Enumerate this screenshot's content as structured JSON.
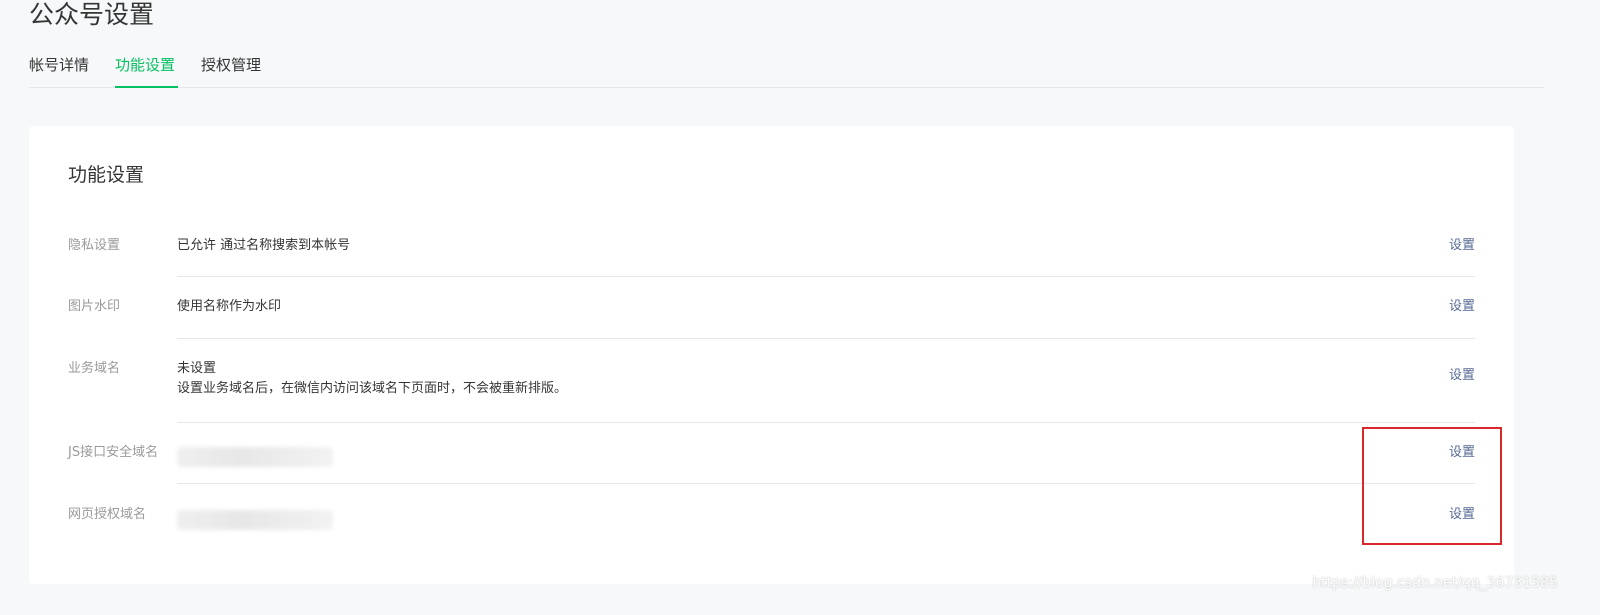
{
  "page": {
    "title": "公众号设置"
  },
  "tabs": [
    {
      "label": "帐号详情",
      "active": false
    },
    {
      "label": "功能设置",
      "active": true
    },
    {
      "label": "授权管理",
      "active": false
    }
  ],
  "card": {
    "title": "功能设置",
    "rows": [
      {
        "label": "隐私设置",
        "value": "已允许 通过名称搜索到本帐号",
        "action": "设置"
      },
      {
        "label": "图片水印",
        "value": "使用名称作为水印",
        "action": "设置"
      },
      {
        "label": "业务域名",
        "value": "未设置",
        "note": "设置业务域名后，在微信内访问该域名下页面时，不会被重新排版。",
        "action": "设置"
      },
      {
        "label": "JS接口安全域名",
        "value": "",
        "action": "设置"
      },
      {
        "label": "网页授权域名",
        "value": "",
        "action": "设置"
      }
    ]
  },
  "watermark": "https://blog.csdn.net/qq_36731585",
  "colors": {
    "accent": "#07c160",
    "link": "#576b95",
    "highlight": "#d9272e"
  }
}
